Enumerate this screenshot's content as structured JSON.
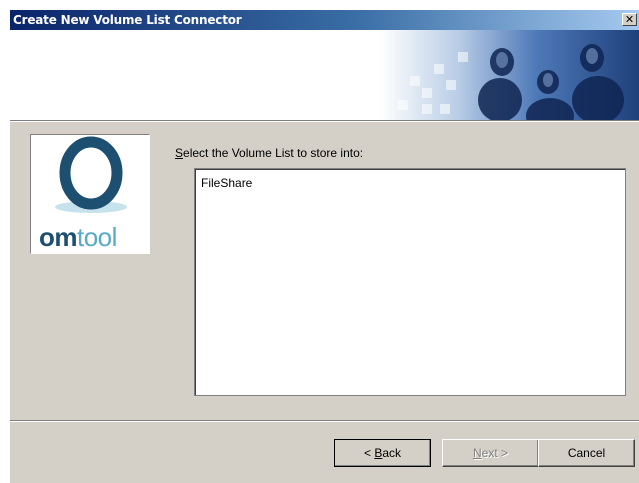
{
  "window": {
    "title": "Create New Volume List Connector",
    "close_glyph": "✕"
  },
  "logo": {
    "text_bold": "om",
    "text_light": "tool",
    "brand_color": "#1d4f70",
    "accent_color": "#5aa9c8"
  },
  "form": {
    "prompt_accel": "S",
    "prompt_rest": "elect the Volume List to store into:",
    "volume_lists": [
      "FileShare"
    ]
  },
  "buttons": {
    "back_prefix": "< ",
    "back_accel": "B",
    "back_rest": "ack",
    "next_accel": "N",
    "next_rest": "ext >",
    "cancel": "Cancel"
  },
  "colors": {
    "titlebar_start": "#0a246a",
    "titlebar_end": "#a6caf0",
    "dialog_face": "#d4d0c8"
  }
}
